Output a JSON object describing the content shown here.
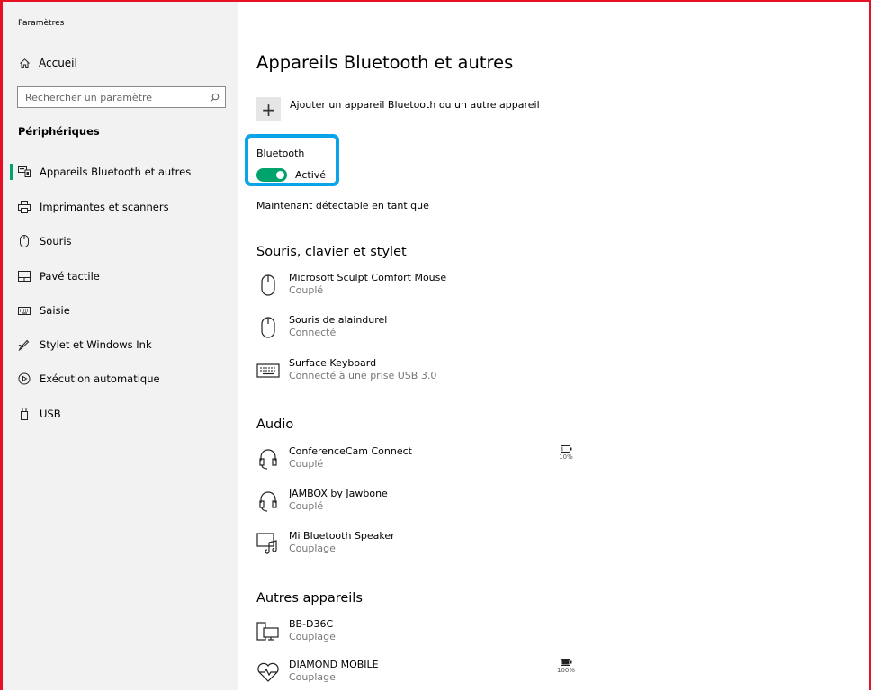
{
  "window": {
    "title": "Paramètres"
  },
  "sidebar": {
    "home_label": "Accueil",
    "search_placeholder": "Rechercher un paramètre",
    "section_title": "Périphériques",
    "items": [
      {
        "label": "Appareils Bluetooth et autres",
        "icon": "bluetooth-devices-icon",
        "active": true
      },
      {
        "label": "Imprimantes et scanners",
        "icon": "printer-icon",
        "active": false
      },
      {
        "label": "Souris",
        "icon": "mouse-icon",
        "active": false
      },
      {
        "label": "Pavé tactile",
        "icon": "touchpad-icon",
        "active": false
      },
      {
        "label": "Saisie",
        "icon": "keyboard-icon",
        "active": false
      },
      {
        "label": "Stylet et Windows Ink",
        "icon": "pen-icon",
        "active": false
      },
      {
        "label": "Exécution automatique",
        "icon": "autoplay-icon",
        "active": false
      },
      {
        "label": "USB",
        "icon": "usb-icon",
        "active": false
      }
    ]
  },
  "main": {
    "title": "Appareils Bluetooth et autres",
    "add_label": "Ajouter un appareil Bluetooth ou un autre appareil",
    "add_symbol": "+",
    "bluetooth": {
      "label": "Bluetooth",
      "state": "Activé",
      "on": true
    },
    "discoverable_text": "Maintenant détectable en tant que",
    "groups": [
      {
        "title": "Souris, clavier et stylet",
        "devices": [
          {
            "name": "Microsoft Sculpt Comfort Mouse",
            "status": "Couplé",
            "icon": "mouse-icon"
          },
          {
            "name": "Souris de alaindurel",
            "status": "Connecté",
            "icon": "mouse-icon"
          },
          {
            "name": "Surface Keyboard",
            "status": "Connecté à une prise USB 3.0",
            "icon": "keyboard-icon"
          }
        ]
      },
      {
        "title": "Audio",
        "devices": [
          {
            "name": "ConferenceCam Connect",
            "status": "Couplé",
            "icon": "headset-icon",
            "battery": "10%",
            "battery_level": 0.1
          },
          {
            "name": "JAMBOX by Jawbone",
            "status": "Couplé",
            "icon": "headset-icon"
          },
          {
            "name": "Mi Bluetooth Speaker",
            "status": "Couplage",
            "icon": "speaker-icon"
          }
        ]
      },
      {
        "title": "Autres appareils",
        "devices": [
          {
            "name": "BB-D36C",
            "status": "Couplage",
            "icon": "computer-icon"
          },
          {
            "name": "DIAMOND MOBILE",
            "status": "Couplage",
            "icon": "heart-rate-icon",
            "battery": "100%",
            "battery_level": 1.0
          }
        ]
      }
    ]
  },
  "colors": {
    "accent": "#00a36c",
    "highlight": "#0aa4e8",
    "frame": "#e81123"
  }
}
